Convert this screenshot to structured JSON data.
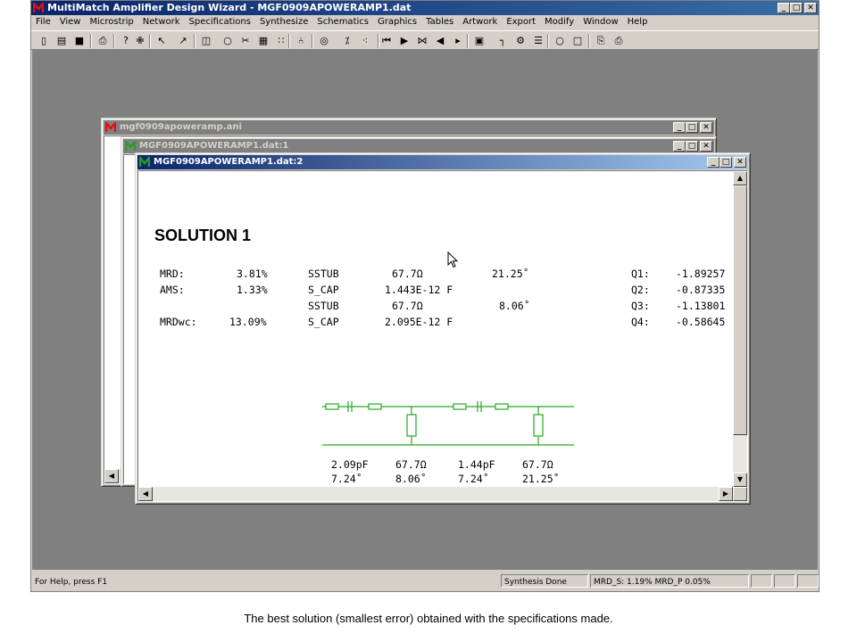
{
  "app": {
    "title": "MultiMatch Amplifier Design Wizard - MGF0909APOWERAMP1.dat",
    "window_buttons": {
      "minimize": "_",
      "restore": "□",
      "close": "✕"
    }
  },
  "menu": [
    "File",
    "View",
    "Microstrip",
    "Network",
    "Specifications",
    "Synthesize",
    "Schematics",
    "Graphics",
    "Tables",
    "Artwork",
    "Export",
    "Modify",
    "Window",
    "Help"
  ],
  "toolbar_icons": [
    "new-icon",
    "open-icon",
    "save-icon",
    "print-icon",
    "help-context-icon",
    "run-icon",
    "pointer-a-icon",
    "pointer-b-icon",
    "fit-icon",
    "circle-icon",
    "cut-icon",
    "grid-icon",
    "tree-icon",
    "link-icon",
    "target-icon",
    "probe-icon",
    "split-icon",
    "first-icon",
    "play-icon",
    "bowtie-icon",
    "prev-icon",
    "next-icon",
    "page-icon",
    "tap-icon",
    "gear-icon",
    "list-icon",
    "circle-yellow-icon",
    "square-yellow-icon",
    "copy-icon",
    "paste-icon"
  ],
  "toolbar_glyphs": [
    "▯",
    "▤",
    "■",
    "⎙",
    "?",
    "✙",
    "↖",
    "↗",
    "◫",
    "○",
    "✂",
    "▦",
    "∷",
    "⑃",
    "◎",
    "⁒",
    "⁖",
    "⏮",
    "▶",
    "⋈",
    "◀",
    "▸",
    "▣",
    "┐",
    "⚙",
    "☰",
    "○",
    "□",
    "⎘",
    "⎙"
  ],
  "status": {
    "help": "For Help, press F1",
    "synthesis": "Synthesis Done",
    "mrd": "MRD_S:  1.19% MRD_P  0.05%"
  },
  "windows": {
    "ani": {
      "title": "mgf0909apoweramp.ani"
    },
    "dat1": {
      "title": "MGF0909APOWERAMP1.dat:1"
    },
    "dat2": {
      "title": "MGF0909APOWERAMP1.dat:2"
    }
  },
  "solution": {
    "title": "SOLUTION 1",
    "rows": [
      {
        "metric": "MRD:",
        "value": "3.81%",
        "element": "SSTUB",
        "param": "67.7Ω",
        "angle": "21.25˚",
        "q": "Q1:",
        "qval": "-1.89257"
      },
      {
        "metric": "AMS:",
        "value": "1.33%",
        "element": "S_CAP",
        "param": "1.443E-12 F",
        "angle": "",
        "q": "Q2:",
        "qval": "-0.87335"
      },
      {
        "metric": "",
        "value": "",
        "element": "SSTUB",
        "param": "67.7Ω",
        "angle": "8.06˚",
        "q": "Q3:",
        "qval": "-1.13801"
      },
      {
        "metric": "MRDwc:",
        "value": "13.09%",
        "element": "S_CAP",
        "param": "2.095E-12 F",
        "angle": "",
        "q": "Q4:",
        "qval": "-0.58645"
      }
    ],
    "schematic_labels_top": [
      "2.09pF",
      "67.7Ω",
      "1.44pF",
      "67.7Ω"
    ],
    "schematic_labels_bottom": [
      "7.24˚",
      "8.06˚",
      "7.24˚",
      "21.25˚"
    ]
  },
  "colors": {
    "schematic": "#22aa22",
    "titlebar_active": "#0a246a"
  },
  "caption": "The best solution (smallest error) obtained with the specifications made."
}
